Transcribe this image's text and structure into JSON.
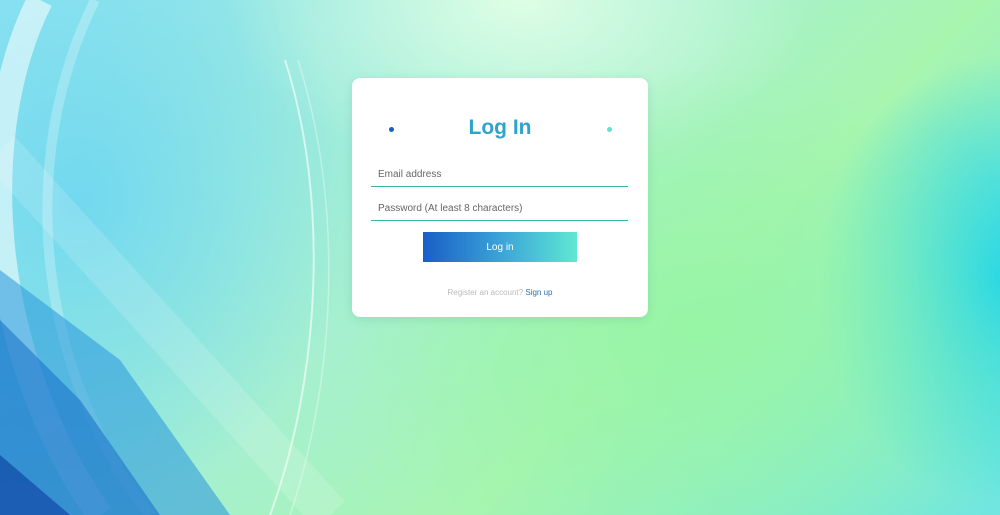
{
  "login_card": {
    "title": "Log In",
    "email_placeholder": "Email address",
    "password_placeholder": "Password (At least 8 characters)",
    "login_button_label": "Log in",
    "register_prompt": "Register an account?",
    "signup_link_label": "Sign up"
  },
  "colors": {
    "title": "#2fa3c9",
    "button_gradient_start": "#1a5ec6",
    "button_gradient_end": "#5fe8d3",
    "input_underline": "#3bb3a6",
    "link": "#2a72c2",
    "left_dot": "#1a5fc4",
    "right_dot": "#5fe3cf"
  }
}
